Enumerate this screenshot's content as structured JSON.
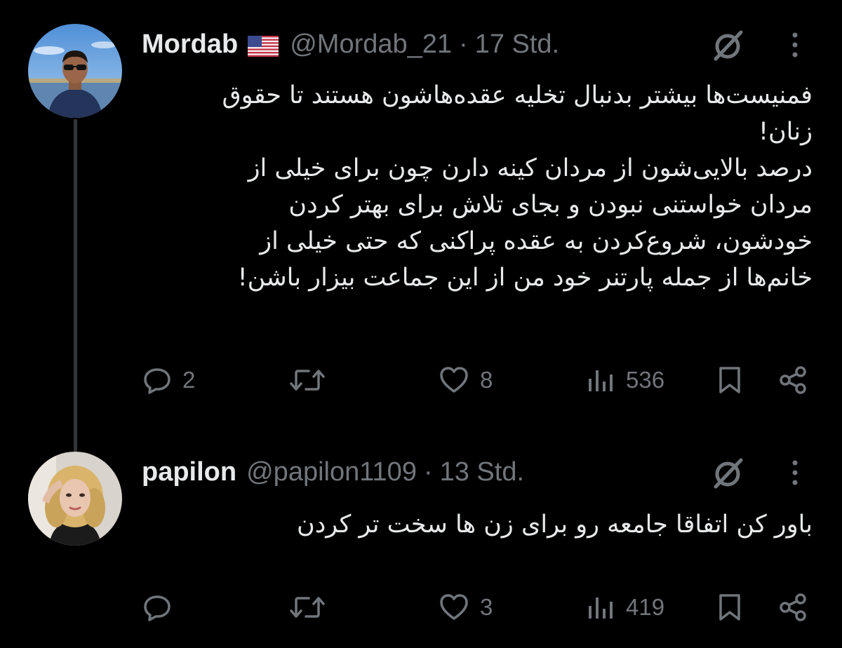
{
  "tweets": [
    {
      "display_name": "Mordab",
      "flag": "us-flag",
      "handle": "@Mordab_21",
      "separator": "·",
      "time": "17 Std.",
      "text_lines": [
        "فمنیست‌ها بیشتر بدنبال تخلیه عقده‌هاشون هستند تا حقوق",
        "زنان!",
        "درصد بالایی‌شون از مردان کینه دارن چون برای خیلی از",
        "مردان خواستنی نبودن و بجای تلاش برای بهتر کردن",
        "خودشون، شروع‌کردن به عقده پراکنی که حتی خیلی از",
        "خانم‌ها از جمله پارتنر خود من از این جماعت بیزار باشن!"
      ],
      "actions": {
        "reply_count": "2",
        "repost_count": "",
        "like_count": "8",
        "views_count": "536"
      }
    },
    {
      "display_name": "papilon",
      "handle": "@papilon1109",
      "separator": "·",
      "time": "13 Std.",
      "text_lines": [
        "باور کن اتفاقا جامعه رو برای زن ها سخت تر کردن"
      ],
      "actions": {
        "reply_count": "",
        "repost_count": "",
        "like_count": "3",
        "views_count": "419"
      }
    }
  ],
  "colors": {
    "background": "#000000",
    "primary_text": "#e7e9ea",
    "secondary_text": "#71767b",
    "thread_line": "#333639"
  },
  "icons": [
    "grok-icon",
    "more-icon",
    "reply-icon",
    "repost-icon",
    "like-icon",
    "views-icon",
    "bookmark-icon",
    "share-icon"
  ]
}
